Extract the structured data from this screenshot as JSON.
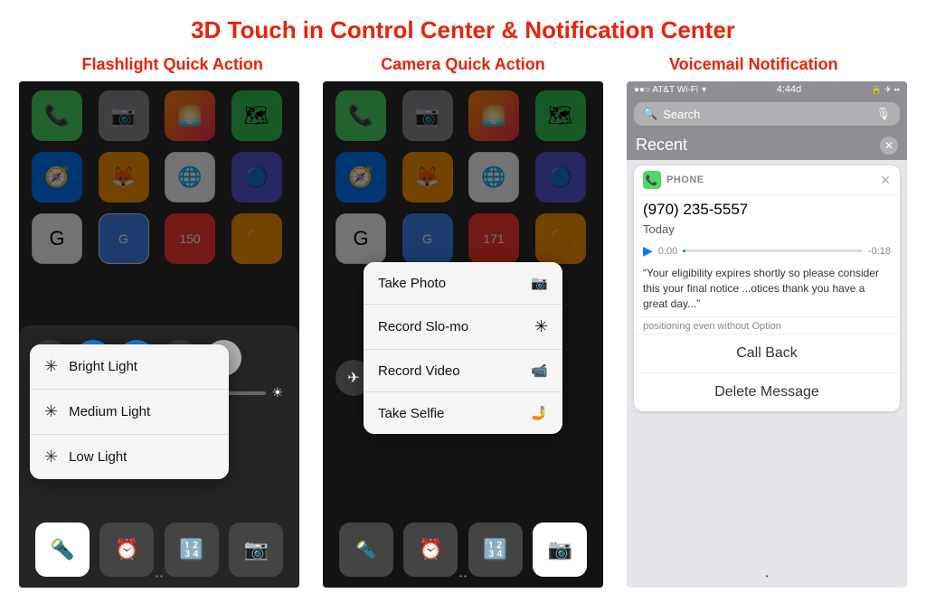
{
  "page": {
    "title": "3D Touch in Control Center & Notification Center",
    "section1_header": "Flashlight Quick Action",
    "section2_header": "Camera Quick Action",
    "section3_header": "Voicemail Notification"
  },
  "flashlight": {
    "menu_items": [
      {
        "label": "Bright Light",
        "icon": "✳"
      },
      {
        "label": "Medium Light",
        "icon": "✳"
      },
      {
        "label": "Low Light",
        "icon": "✳"
      }
    ]
  },
  "camera": {
    "menu_items": [
      {
        "label": "Take Photo",
        "icon": "📷"
      },
      {
        "label": "Record Slo-mo",
        "icon": "✳"
      },
      {
        "label": "Record Video",
        "icon": "📹"
      },
      {
        "label": "Take Selfie",
        "icon": "🤳"
      }
    ]
  },
  "voicemail": {
    "status_bar": "●●○ AT&T Wi-Fi ▾  🔒 4:44d  ✈ ◉ ▪",
    "search_placeholder": "Search",
    "recent_label": "Recent",
    "phone_label": "PHONE",
    "phone_number": "(970) 235-5557",
    "call_time": "Today",
    "audio_start": "0:00",
    "audio_end": "-0:18",
    "transcript": "“Your eligibility expires shortly so please consider this your final notice ...otices thank you have a great day...”",
    "partial_text": "positioning even without Option",
    "call_back_label": "Call Back",
    "delete_label": "Delete Message"
  },
  "colors": {
    "title_red": "#e8230a",
    "blue": "#007aff",
    "green": "#4cd964",
    "accent": "#1a7fdb"
  }
}
